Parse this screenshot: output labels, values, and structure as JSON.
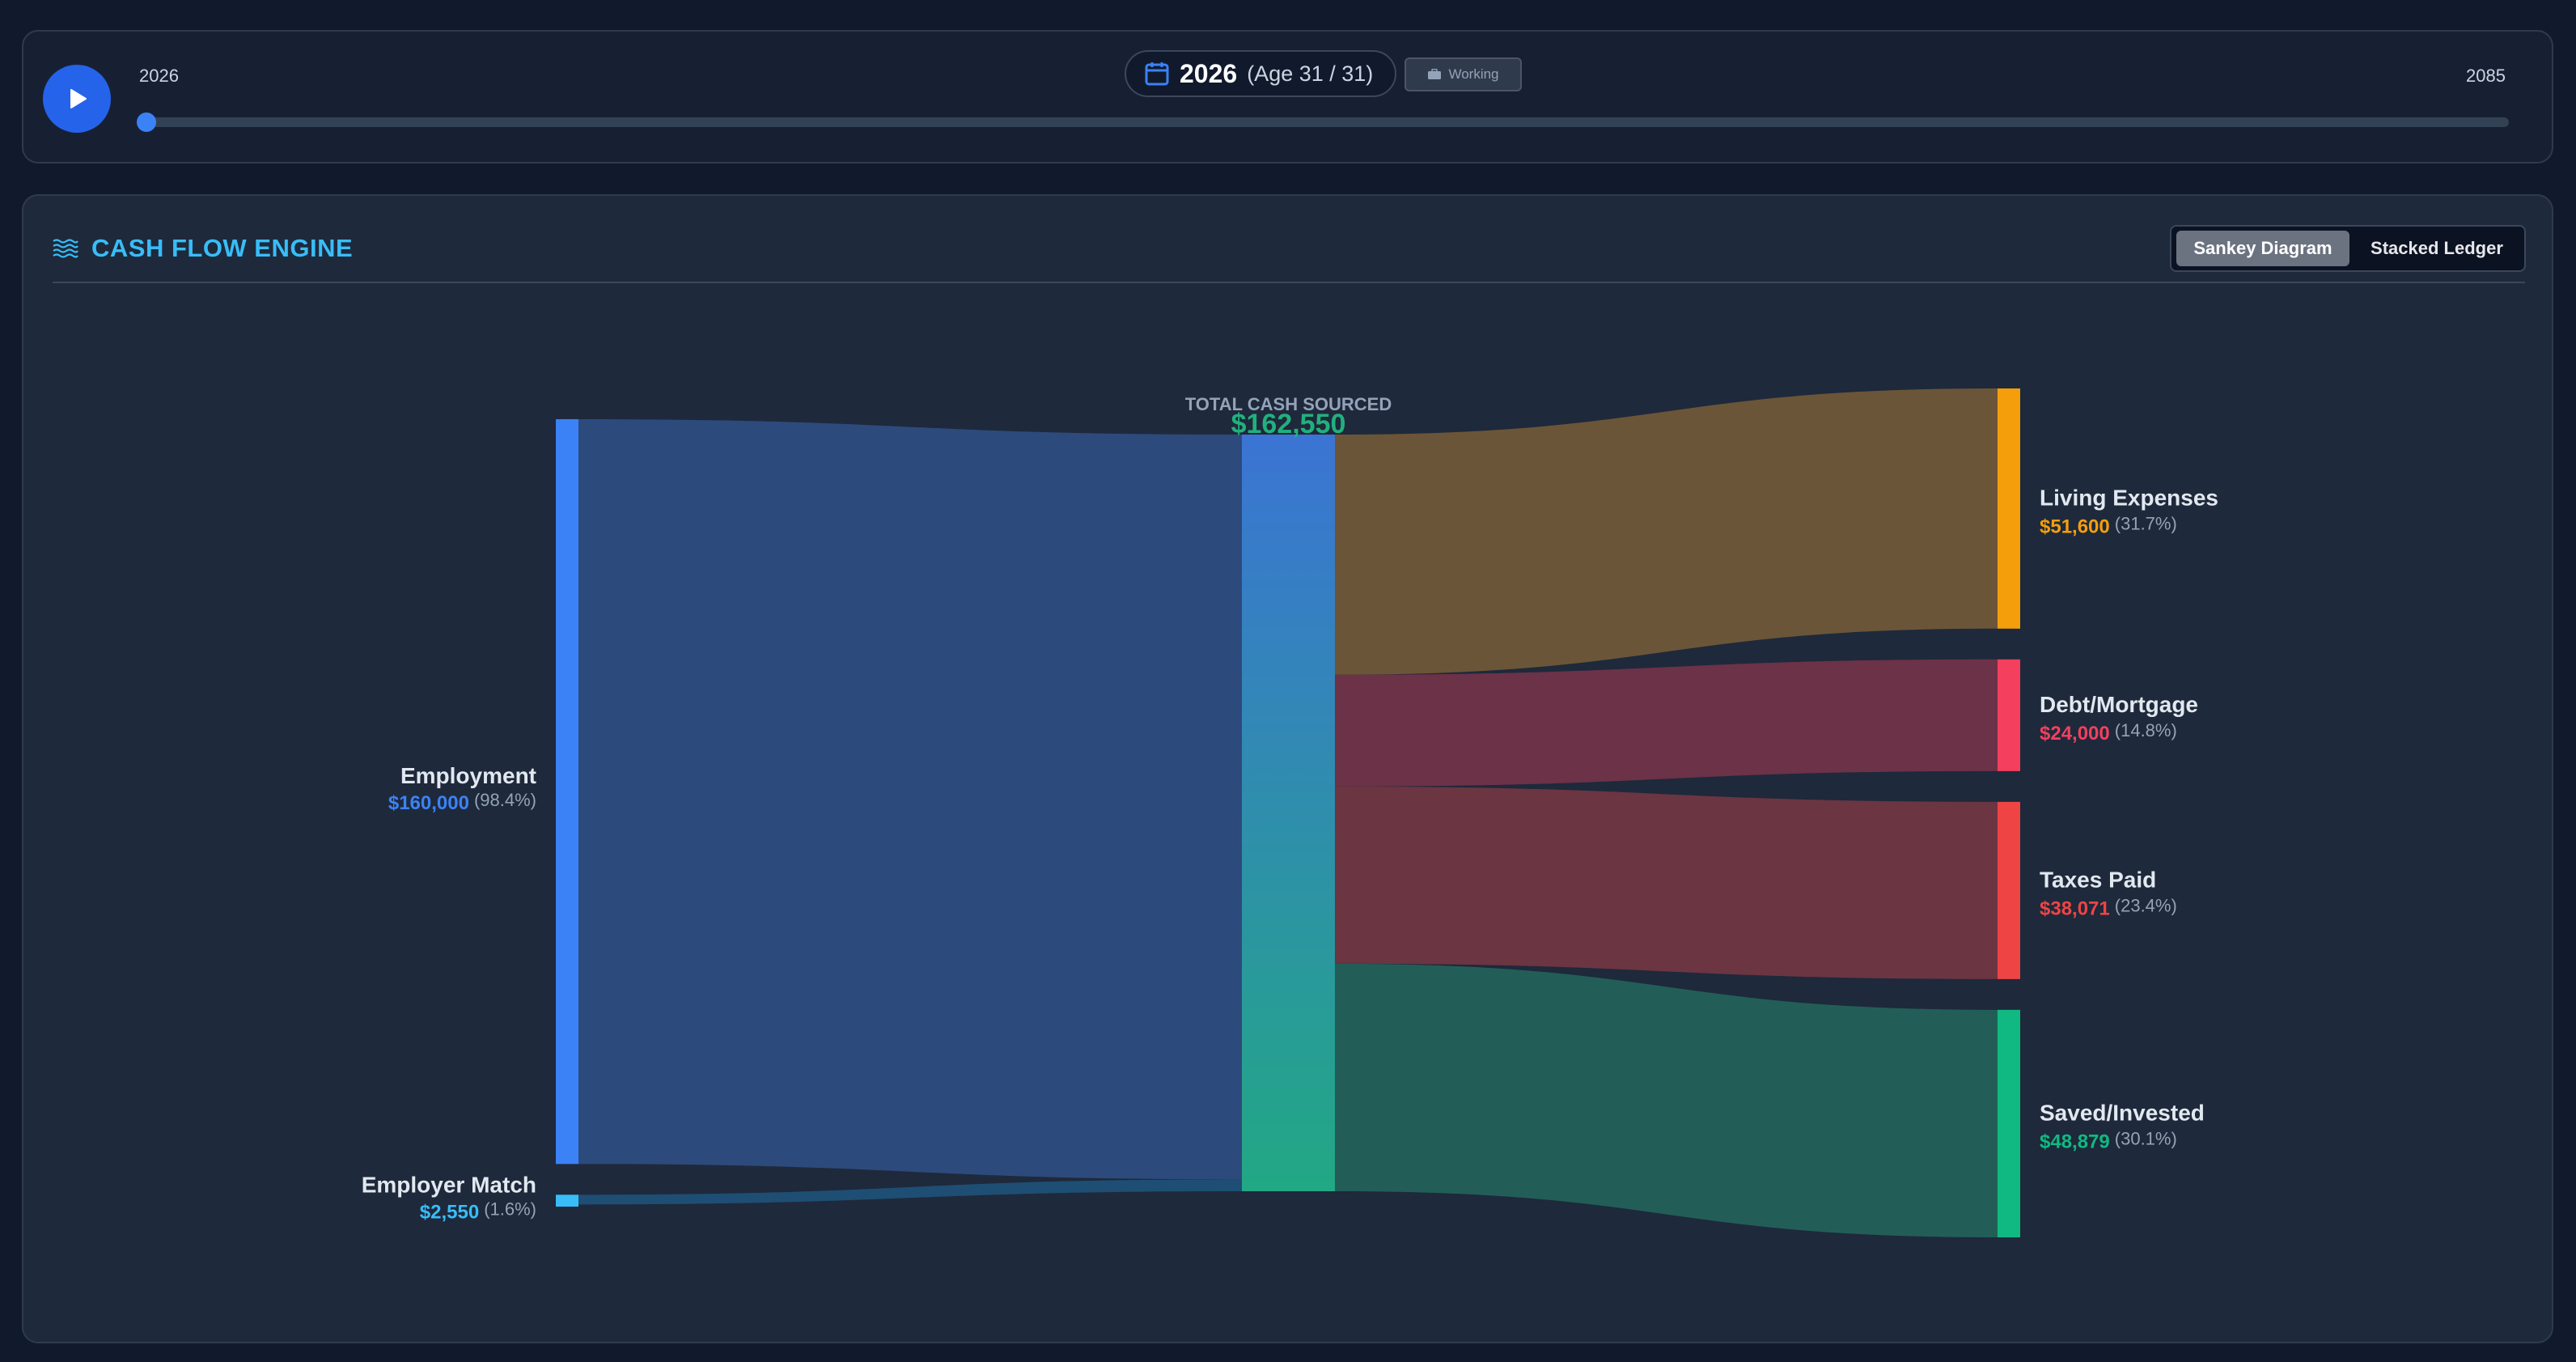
{
  "timeline": {
    "start_year": "2026",
    "end_year": "2085",
    "current_year": "2026",
    "age_label": "(Age 31 / 31)",
    "status": "Working",
    "progress": 0
  },
  "panel": {
    "title": "CASH FLOW ENGINE",
    "views": [
      "Sankey Diagram",
      "Stacked Ledger"
    ],
    "active_view": "Sankey Diagram"
  },
  "chart_data": {
    "type": "sankey",
    "center": {
      "label": "TOTAL CASH SOURCED",
      "value": "$162,550",
      "amount": 162550
    },
    "sources": [
      {
        "name": "Employment",
        "value_label": "$160,000",
        "pct": "(98.4%)",
        "amount": 160000,
        "color": "#3b82f6"
      },
      {
        "name": "Employer Match",
        "value_label": "$2,550",
        "pct": "(1.6%)",
        "amount": 2550,
        "color": "#38bdf8"
      }
    ],
    "targets": [
      {
        "name": "Living Expenses",
        "value_label": "$51,600",
        "pct": "(31.7%)",
        "amount": 51600,
        "color": "#f59e0b"
      },
      {
        "name": "Debt/Mortgage",
        "value_label": "$24,000",
        "pct": "(14.8%)",
        "amount": 24000,
        "color": "#f43f5e"
      },
      {
        "name": "Taxes Paid",
        "value_label": "$38,071",
        "pct": "(23.4%)",
        "amount": 38071,
        "color": "#ef4444"
      },
      {
        "name": "Saved/Invested",
        "value_label": "$48,879",
        "pct": "(30.1%)",
        "amount": 48879,
        "color": "#10b981"
      }
    ]
  }
}
